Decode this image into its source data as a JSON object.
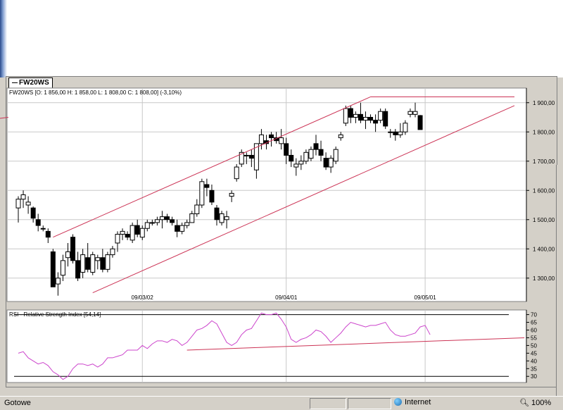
{
  "window": {
    "tab_label": "FW20WS"
  },
  "status": {
    "left_text": "Gotowe",
    "zone_label": "Internet",
    "zoom": "100%"
  },
  "colors": {
    "up": "#ffffff",
    "down": "#000000",
    "trend": "#cc3355",
    "rsi": "#cc44cc",
    "grid": "#c8c8c8"
  },
  "chart_data": [
    {
      "type": "candlestick",
      "header": "FW20WS [O: 1 856,00  H: 1 858,00  L: 1 808,00  C: 1 808,00] (-3,10%)",
      "ylim": [
        1220,
        1950
      ],
      "y_ticks": [
        1300,
        1400,
        1500,
        1600,
        1700,
        1800,
        1900
      ],
      "y_tick_labels": [
        "1 300,00",
        "1 400,00",
        "1 500,00",
        "1 600,00",
        "1 700,00",
        "1 800,00",
        "1 900,00"
      ],
      "x_tick_labels": [
        "09/03/02",
        "09/04/01",
        "09/05/01"
      ],
      "x_tick_index": [
        25,
        54,
        82
      ],
      "candles": [
        [
          1540,
          1580,
          1490,
          1570
        ],
        [
          1570,
          1600,
          1540,
          1585
        ],
        [
          1550,
          1580,
          1520,
          1560
        ],
        [
          1540,
          1545,
          1490,
          1505
        ],
        [
          1500,
          1520,
          1460,
          1480
        ],
        [
          1470,
          1480,
          1460,
          1470
        ],
        [
          1460,
          1470,
          1420,
          1440
        ],
        [
          1390,
          1400,
          1300,
          1270
        ],
        [
          1280,
          1320,
          1240,
          1300
        ],
        [
          1310,
          1380,
          1290,
          1360
        ],
        [
          1370,
          1420,
          1340,
          1390
        ],
        [
          1440,
          1450,
          1350,
          1360
        ],
        [
          1360,
          1390,
          1290,
          1300
        ],
        [
          1320,
          1400,
          1300,
          1380
        ],
        [
          1370,
          1420,
          1320,
          1330
        ],
        [
          1320,
          1390,
          1310,
          1380
        ],
        [
          1360,
          1380,
          1330,
          1370
        ],
        [
          1370,
          1400,
          1320,
          1330
        ],
        [
          1330,
          1390,
          1320,
          1380
        ],
        [
          1380,
          1410,
          1370,
          1400
        ],
        [
          1420,
          1460,
          1390,
          1450
        ],
        [
          1450,
          1470,
          1430,
          1460
        ],
        [
          1450,
          1460,
          1430,
          1440
        ],
        [
          1430,
          1490,
          1420,
          1480
        ],
        [
          1480,
          1500,
          1440,
          1450
        ],
        [
          1440,
          1480,
          1430,
          1470
        ],
        [
          1470,
          1500,
          1460,
          1490
        ],
        [
          1490,
          1500,
          1480,
          1490
        ],
        [
          1490,
          1510,
          1480,
          1500
        ],
        [
          1500,
          1530,
          1470,
          1510
        ],
        [
          1510,
          1520,
          1490,
          1500
        ],
        [
          1500,
          1510,
          1480,
          1490
        ],
        [
          1480,
          1500,
          1440,
          1460
        ],
        [
          1460,
          1490,
          1450,
          1480
        ],
        [
          1480,
          1500,
          1470,
          1490
        ],
        [
          1490,
          1530,
          1490,
          1520
        ],
        [
          1520,
          1570,
          1510,
          1550
        ],
        [
          1550,
          1640,
          1540,
          1630
        ],
        [
          1620,
          1640,
          1580,
          1610
        ],
        [
          1600,
          1620,
          1550,
          1560
        ],
        [
          1540,
          1550,
          1480,
          1500
        ],
        [
          1490,
          1530,
          1480,
          1520
        ],
        [
          1500,
          1530,
          1470,
          1510
        ],
        [
          1580,
          1600,
          1560,
          1590
        ],
        [
          1640,
          1690,
          1630,
          1680
        ],
        [
          1690,
          1740,
          1680,
          1730
        ],
        [
          1720,
          1730,
          1690,
          1720
        ],
        [
          1720,
          1740,
          1680,
          1710
        ],
        [
          1670,
          1750,
          1640,
          1760
        ],
        [
          1760,
          1810,
          1740,
          1790
        ],
        [
          1770,
          1790,
          1740,
          1760
        ],
        [
          1790,
          1800,
          1750,
          1780
        ],
        [
          1780,
          1800,
          1760,
          1770
        ],
        [
          1760,
          1810,
          1740,
          1780
        ],
        [
          1760,
          1780,
          1690,
          1720
        ],
        [
          1720,
          1740,
          1680,
          1700
        ],
        [
          1680,
          1710,
          1650,
          1690
        ],
        [
          1690,
          1720,
          1670,
          1700
        ],
        [
          1700,
          1740,
          1690,
          1730
        ],
        [
          1710,
          1750,
          1700,
          1740
        ],
        [
          1760,
          1790,
          1720,
          1740
        ],
        [
          1740,
          1770,
          1700,
          1720
        ],
        [
          1710,
          1730,
          1670,
          1680
        ],
        [
          1680,
          1720,
          1660,
          1710
        ],
        [
          1700,
          1750,
          1690,
          1740
        ],
        [
          1780,
          1800,
          1770,
          1790
        ],
        [
          1830,
          1890,
          1820,
          1880
        ],
        [
          1880,
          1890,
          1830,
          1850
        ],
        [
          1850,
          1870,
          1830,
          1860
        ],
        [
          1860,
          1900,
          1830,
          1840
        ],
        [
          1840,
          1870,
          1810,
          1850
        ],
        [
          1850,
          1860,
          1830,
          1840
        ],
        [
          1840,
          1860,
          1800,
          1830
        ],
        [
          1840,
          1880,
          1830,
          1870
        ],
        [
          1870,
          1880,
          1810,
          1820
        ],
        [
          1800,
          1810,
          1780,
          1800
        ],
        [
          1800,
          1810,
          1770,
          1790
        ],
        [
          1790,
          1830,
          1780,
          1800
        ],
        [
          1800,
          1840,
          1790,
          1830
        ],
        [
          1860,
          1880,
          1850,
          1870
        ],
        [
          1860,
          1900,
          1850,
          1870
        ],
        [
          1856,
          1858,
          1808,
          1808
        ]
      ],
      "trendlines": [
        {
          "from": [
            -16,
            1820
          ],
          "to": [
            -2,
            1850
          ]
        },
        {
          "from": [
            7,
            1440
          ],
          "to": [
            71,
            1920
          ]
        },
        {
          "from": [
            15,
            1250
          ],
          "to": [
            100,
            1890
          ]
        },
        {
          "from": [
            71,
            1920
          ],
          "to": [
            100,
            1920
          ]
        }
      ]
    },
    {
      "type": "line",
      "header": "RSI - Relative Strength Index [54,14]",
      "ylim": [
        26,
        73
      ],
      "y_ticks": [
        30,
        35,
        40,
        45,
        50,
        55,
        60,
        65,
        70
      ],
      "y_tick_labels": [
        "30",
        "35",
        "40",
        "45",
        "50",
        "55",
        "60",
        "65",
        "70"
      ],
      "reference_lines": [
        30,
        70
      ],
      "trendline": {
        "from": [
          34,
          47
        ],
        "to": [
          102,
          55
        ]
      },
      "series": [
        {
          "values": [
            45,
            46,
            42,
            40,
            38,
            39,
            37,
            33,
            31,
            28,
            30,
            35,
            38,
            38,
            37,
            38,
            36,
            38,
            42,
            42,
            43,
            44,
            47,
            47,
            47,
            50,
            48,
            51,
            53,
            53,
            52,
            54,
            53,
            50,
            52,
            56,
            60,
            61,
            63,
            66,
            64,
            58,
            52,
            50,
            52,
            57,
            60,
            61,
            66,
            71,
            70,
            70,
            71,
            67,
            62,
            54,
            52,
            54,
            55,
            57,
            60,
            59,
            56,
            52,
            55,
            58,
            62,
            65,
            64,
            63,
            62,
            63,
            63,
            64,
            65,
            60,
            57,
            56,
            56,
            57,
            58,
            62,
            63,
            57
          ]
        }
      ]
    }
  ]
}
